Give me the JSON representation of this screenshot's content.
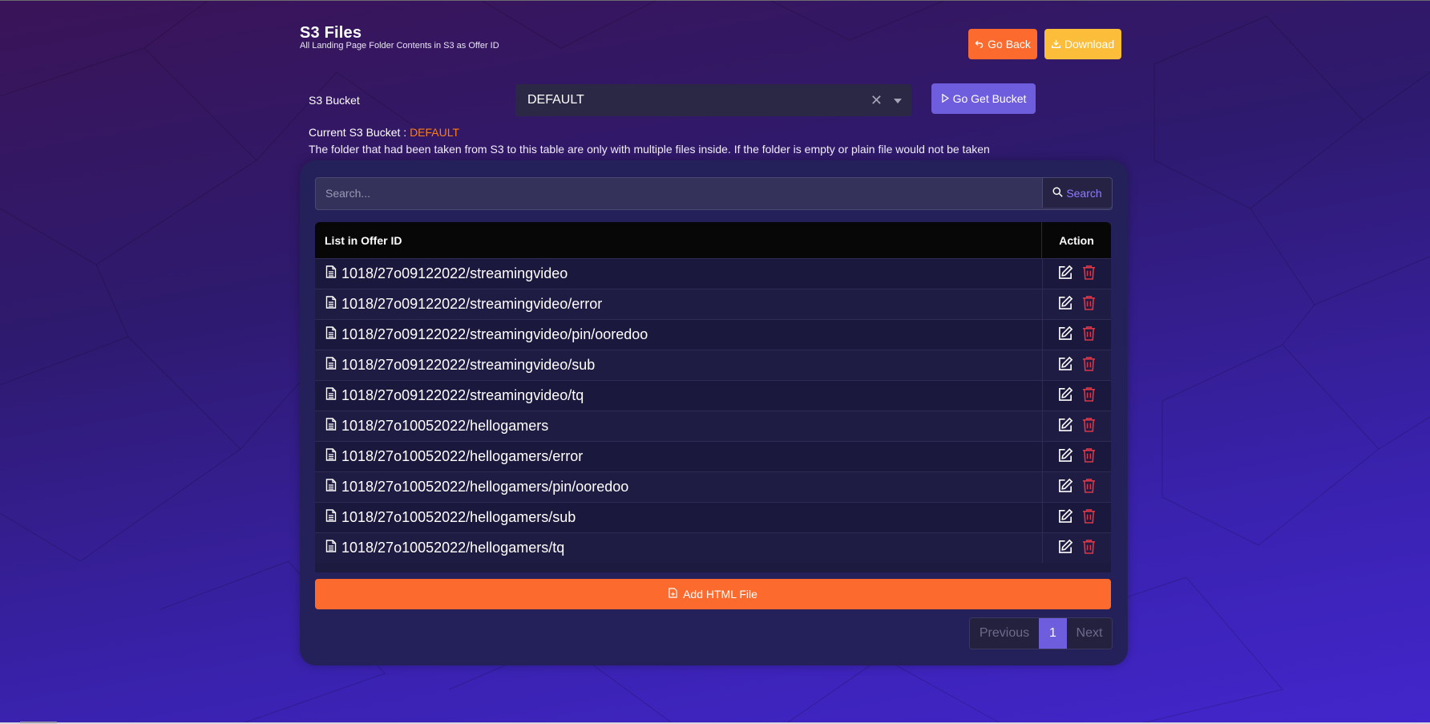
{
  "header": {
    "title": "S3 Files",
    "subtitle": "All Landing Page Folder Contents in S3 as Offer ID"
  },
  "actions": {
    "back_label": "Go Back",
    "download_label": "Download"
  },
  "bucket_form": {
    "label": "S3 Bucket",
    "selected": "DEFAULT",
    "go_label": "Go Get Bucket"
  },
  "info": {
    "current_prefix": "Current S3 Bucket : ",
    "current_value": "DEFAULT",
    "note": "The folder that had been taken from S3 to this table are only with multiple files inside. If the folder is empty or plain file would not be taken"
  },
  "search": {
    "placeholder": "Search...",
    "button_label": "Search"
  },
  "table": {
    "columns": [
      "List in Offer ID",
      "Action"
    ],
    "rows": [
      "1018/27o09122022/streamingvideo",
      "1018/27o09122022/streamingvideo/error",
      "1018/27o09122022/streamingvideo/pin/ooredoo",
      "1018/27o09122022/streamingvideo/sub",
      "1018/27o09122022/streamingvideo/tq",
      "1018/27o10052022/hellogamers",
      "1018/27o10052022/hellogamers/error",
      "1018/27o10052022/hellogamers/pin/ooredoo",
      "1018/27o10052022/hellogamers/sub",
      "1018/27o10052022/hellogamers/tq"
    ]
  },
  "add_button": {
    "label": "Add HTML File"
  },
  "pagination": {
    "previous": "Previous",
    "current": "1",
    "next": "Next"
  },
  "colors": {
    "accent_orange": "#fd6a2e",
    "accent_yellow": "#fbbd3a",
    "accent_purple": "#6e5ddc",
    "delete_red": "#dc3545"
  },
  "icons": {
    "row_icon": "file-icon",
    "edit": "edit-icon",
    "delete": "trash-icon"
  }
}
